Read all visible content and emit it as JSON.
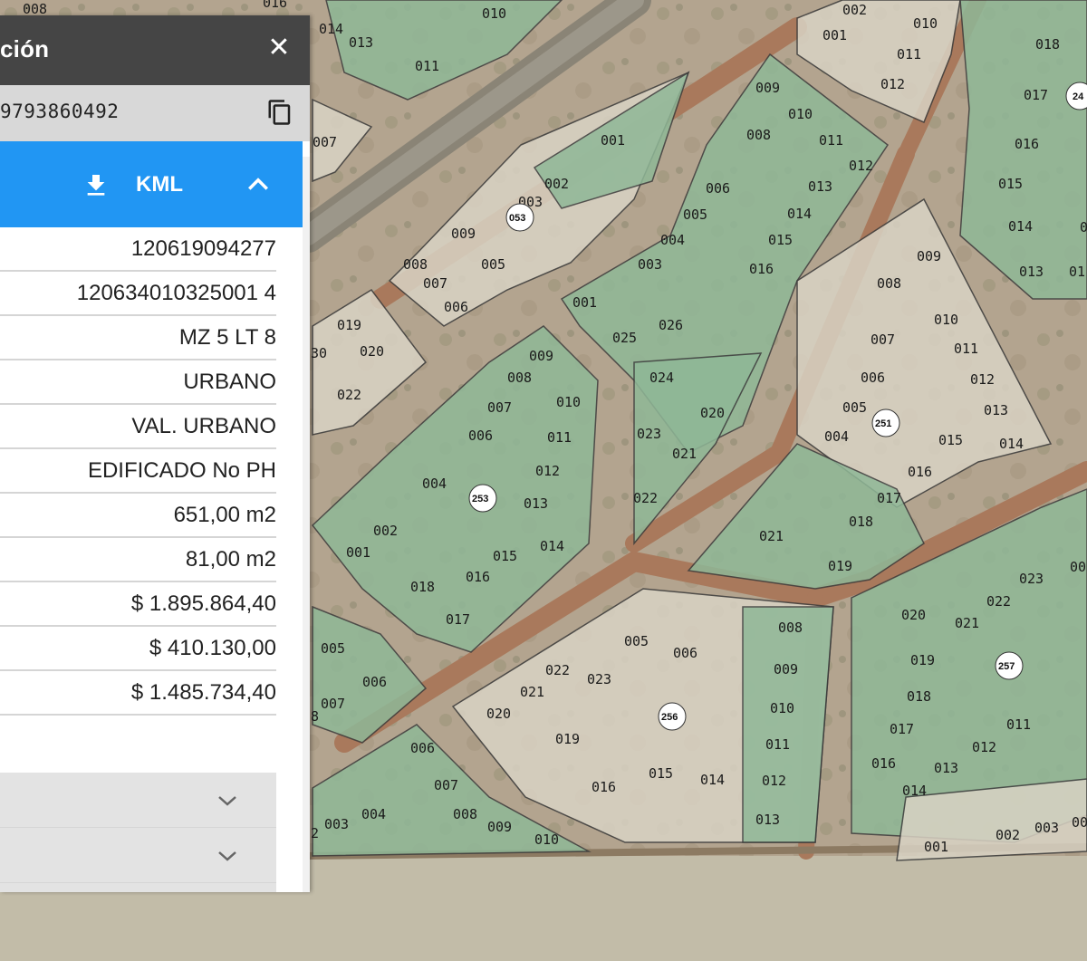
{
  "panel": {
    "title": "ción",
    "close_icon": "close-icon",
    "id_text": "9793860492",
    "copy_icon": "copy-icon",
    "kml": {
      "label": "KML",
      "icon": "download-icon",
      "collapse_icon": "chevron-up-icon",
      "color": "#2196f3"
    },
    "rows": [
      "120619094277",
      "120634010325001 4",
      "MZ 5 LT 8",
      "URBANO",
      "VAL. URBANO",
      "EDIFICADO No PH",
      "651,00 m2",
      "81,00 m2",
      "$ 1.895.864,40",
      "$ 410.130,00",
      "$ 1.485.734,40"
    ],
    "accordion_icons": [
      "chevron-down-icon",
      "chevron-down-icon"
    ]
  },
  "map": {
    "blocks": [
      "053",
      "251",
      "253",
      "256",
      "257"
    ],
    "lots": [
      "008",
      "016",
      "015",
      "014",
      "013",
      "011",
      "010",
      "012",
      "007",
      "001",
      "002",
      "010",
      "011",
      "012",
      "018",
      "017",
      "24",
      "016",
      "015",
      "014",
      "013",
      "01",
      "009",
      "010",
      "008",
      "011",
      "012",
      "013",
      "014",
      "015",
      "016",
      "006",
      "005",
      "004",
      "003",
      "001",
      "002",
      "003",
      "009",
      "005",
      "008",
      "007",
      "006",
      "019",
      "020",
      "022",
      "30",
      "025",
      "026",
      "024",
      "020",
      "023",
      "021",
      "022",
      "009",
      "008",
      "007",
      "006",
      "010",
      "011",
      "012",
      "013",
      "004",
      "014",
      "002",
      "001",
      "015",
      "016",
      "018",
      "017",
      "009",
      "008",
      "010",
      "007",
      "011",
      "006",
      "012",
      "005",
      "004",
      "013",
      "014",
      "015",
      "016",
      "017",
      "018",
      "021",
      "019",
      "008",
      "005",
      "006",
      "009",
      "010",
      "022",
      "023",
      "021",
      "020",
      "019",
      "016",
      "015",
      "014",
      "011",
      "012",
      "013",
      "005",
      "006",
      "007",
      "8",
      "020",
      "021",
      "022",
      "023",
      "00",
      "019",
      "018",
      "017",
      "016",
      "014",
      "013",
      "011",
      "012",
      "001",
      "002",
      "003",
      "00",
      "006",
      "007",
      "008",
      "009",
      "010",
      "003",
      "004",
      "2"
    ]
  },
  "colors": {
    "lot_green": "#8fb897",
    "lot_beige": "#d9d3c4",
    "header": "#454545",
    "id_bar": "#d8d8d8"
  }
}
